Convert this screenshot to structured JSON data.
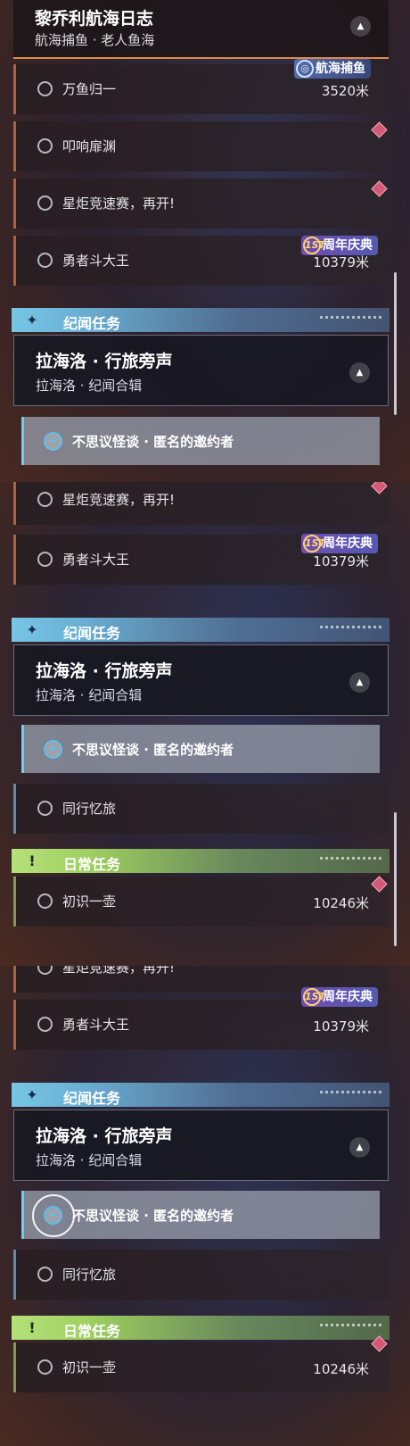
{
  "frame1": {
    "header_card": {
      "title": "黎乔利航海日志",
      "subtitle": "航海捕鱼 · 老人鱼海",
      "collapse_icon": "chevron-up-icon"
    },
    "quests": [
      {
        "label": "万鱼归一",
        "distance": "3520米",
        "badge": "航海捕鱼"
      },
      {
        "label": "叩响扉渊",
        "distance": ""
      },
      {
        "label": "星炬竞速赛，再开!",
        "distance": ""
      },
      {
        "label": "勇者斗大王",
        "distance": "10379米",
        "badge": "周年庆典"
      }
    ],
    "section": {
      "title": "纪闻任务",
      "icon": "sparkle-icon"
    },
    "card": {
      "title": "拉海洛 · 行旅旁声",
      "subtitle": "拉海洛 · 纪闻合辑",
      "collapse_icon": "chevron-up-icon"
    },
    "sub": {
      "label": "不思议怪谈 · 匿名的邀约者",
      "icon": "compass-icon"
    }
  },
  "frame2": {
    "quests": [
      {
        "label": "星炬竞速赛，再开!",
        "distance": ""
      },
      {
        "label": "勇者斗大王",
        "distance": "10379米",
        "badge": "周年庆典"
      }
    ],
    "section": {
      "title": "纪闻任务",
      "icon": "sparkle-icon"
    },
    "card": {
      "title": "拉海洛 · 行旅旁声",
      "subtitle": "拉海洛 · 纪闻合辑",
      "collapse_icon": "chevron-up-icon"
    },
    "sub": {
      "label": "不思议怪谈 · 匿名的邀约者",
      "icon": "compass-icon"
    },
    "companion": {
      "label": "同行忆旅"
    },
    "daily_section": {
      "title": "日常任务",
      "icon": "exclamation-icon",
      "icon_text": "!"
    },
    "daily": {
      "label": "初识一壶",
      "distance": "10246米"
    }
  },
  "frame3": {
    "quests": [
      {
        "label": "星炬竞速赛，再开!",
        "distance": ""
      },
      {
        "label": "勇者斗大王",
        "distance": "10379米",
        "badge": "周年庆典"
      }
    ],
    "section": {
      "title": "纪闻任务",
      "icon": "sparkle-icon"
    },
    "card": {
      "title": "拉海洛 · 行旅旁声",
      "subtitle": "拉海洛 · 纪闻合辑",
      "collapse_icon": "chevron-up-icon"
    },
    "sub": {
      "label": "不思议怪谈 · 匿名的邀约者",
      "icon": "compass-icon"
    },
    "companion": {
      "label": "同行忆旅"
    },
    "daily_section": {
      "title": "日常任务",
      "icon": "exclamation-icon",
      "icon_text": "!"
    },
    "daily": {
      "label": "初识一壶",
      "distance": "10246米"
    }
  },
  "badges": {
    "anni_prefix": "1ST"
  },
  "colors": {
    "section_blue": "#77c6e6",
    "section_green": "#b5e07a",
    "gem": "#d25a78",
    "accent_orange": "#b0623c"
  }
}
